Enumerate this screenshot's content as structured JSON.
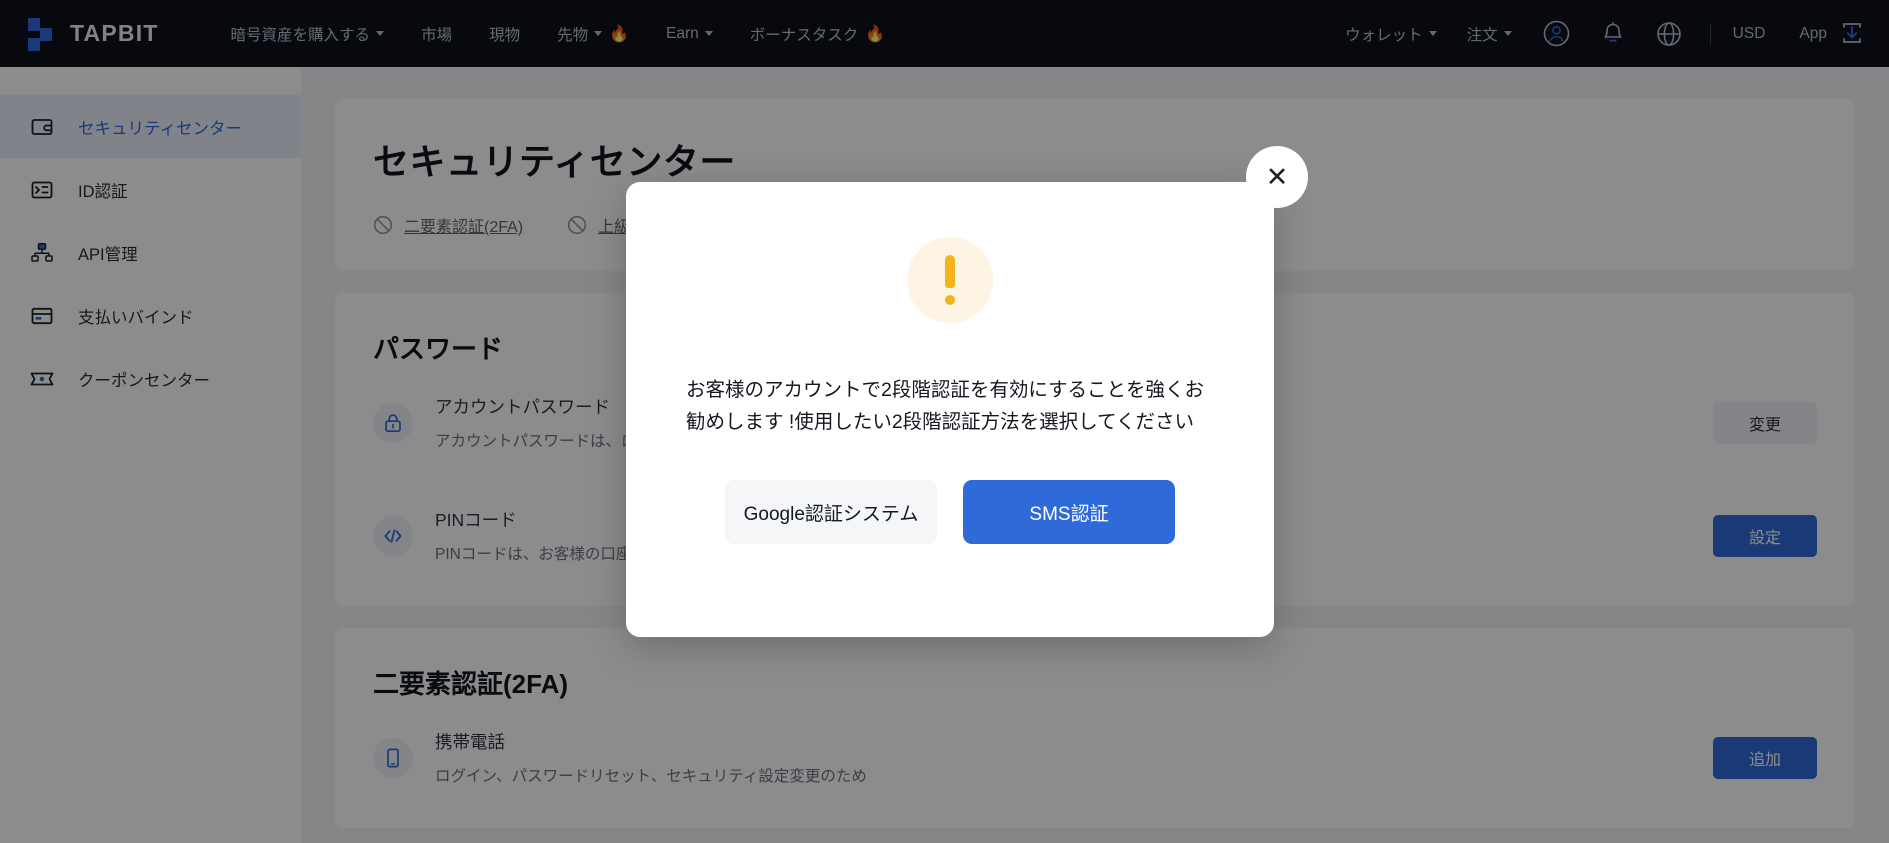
{
  "brand": {
    "name": "TAPBIT",
    "accent": "#2f6bd8"
  },
  "topnav": {
    "items": [
      {
        "label": "暗号資産を購入する",
        "caret": true,
        "flame": false
      },
      {
        "label": "市場",
        "caret": false,
        "flame": false
      },
      {
        "label": "現物",
        "caret": false,
        "flame": false
      },
      {
        "label": "先物",
        "caret": true,
        "flame": true
      },
      {
        "label": "Earn",
        "caret": true,
        "flame": false
      },
      {
        "label": "ボーナスタスク",
        "caret": false,
        "flame": true
      }
    ],
    "right_items": [
      {
        "label": "ウォレット",
        "caret": true
      },
      {
        "label": "注文",
        "caret": true
      }
    ],
    "currency": "USD",
    "app_label": "App",
    "icons": [
      "user-avatar-icon",
      "bell-icon",
      "globe-icon",
      "app-download-icon"
    ]
  },
  "sidebar": {
    "items": [
      {
        "label": "セキュリティセンター",
        "icon": "security-center-icon",
        "active": true
      },
      {
        "label": "ID認証",
        "icon": "id-verification-icon",
        "active": false
      },
      {
        "label": "API管理",
        "icon": "api-management-icon",
        "active": false
      },
      {
        "label": "支払いバインド",
        "icon": "payment-bind-icon",
        "active": false
      },
      {
        "label": "クーポンセンター",
        "icon": "coupon-center-icon",
        "active": false
      }
    ]
  },
  "main": {
    "page_title": "セキュリティセンター",
    "quick_links": [
      {
        "label": "二要素認証(2FA)",
        "icon": "disabled-ban-icon"
      },
      {
        "label": "上級認証",
        "icon": "disabled-ban-icon"
      }
    ],
    "password_section": {
      "title": "パスワード",
      "rows": [
        {
          "icon": "lock-icon",
          "title": "アカウントパスワード",
          "desc": "アカウントパスワードは、ログイン時に使用されます",
          "button": "変更",
          "button_style": "grey"
        },
        {
          "icon": "code-brackets-icon",
          "title": "PINコード",
          "desc": "PINコードは、お客様の口座の安全を守るために使われます",
          "button": "設定",
          "button_style": "blue"
        }
      ]
    },
    "twofa_section": {
      "title": "二要素認証(2FA)",
      "rows": [
        {
          "icon": "mobile-phone-icon",
          "title": "携帯電話",
          "desc": "ログイン、パスワードリセット、セキュリティ設定変更のため",
          "button": "追加",
          "button_style": "blue"
        }
      ]
    }
  },
  "modal": {
    "close_label": "✕",
    "icon": "warning-exclamation-icon",
    "message": "お客様のアカウントで2段階認証を有効にすることを強くお勧めします !使用したい2段階認証方法を選択してください",
    "buttons": [
      {
        "label": "Google認証システム",
        "style": "secondary"
      },
      {
        "label": "SMS認証",
        "style": "primary"
      }
    ]
  }
}
